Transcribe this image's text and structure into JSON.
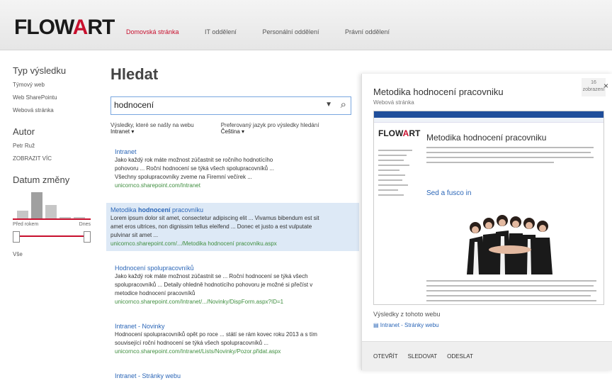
{
  "header": {
    "logo_main": "FLOW",
    "logo_accent": "A",
    "logo_end": "RT",
    "nav": [
      "Domovská stránka",
      "IT oddělení",
      "Personální oddělení",
      "Právní oddělení"
    ]
  },
  "refiners": {
    "type_heading": "Typ výsledku",
    "type_items": [
      "Týmový web",
      "Web SharePointu",
      "Webová stránka"
    ],
    "author_heading": "Autor",
    "author_items": [
      "Petr Ruž",
      "ZOBRAZIT VÍC"
    ],
    "date_heading": "Datum změny",
    "date_from": "Před rokem",
    "date_to": "Dnes",
    "date_all": "Vše"
  },
  "search": {
    "title": "Hledat",
    "query": "hodnocení",
    "scope_label": "Výsledky, které se našly na webu",
    "scope_value": "Intranet",
    "lang_label": "Preferovaný jazyk pro výsledky hledání",
    "lang_value": "Čeština"
  },
  "results": [
    {
      "title": "Intranet",
      "desc1": "Jako každý rok máte možnost zúčastnit se ročního hodnotícího",
      "desc2": "pohovoru ... Roční hodnocení se týká všech spolupracovníků ...",
      "desc3": "Všechny spolupracovníky zveme na Firemní večírek ...",
      "url": "unicornco.sharepoint.com/Intranet"
    },
    {
      "title_pre": "Metodika ",
      "title_bold": "hodnocení",
      "title_post": " pracovníku",
      "desc1": "Lorem ipsum dolor sit amet, consectetur adipiscing elit ... Vivamus bibendum est sit",
      "desc2": "amet eros ultrices, non dignissim tellus eleifend ... Donec et justo a est vulputate",
      "desc3": "pulvinar sit amet ...",
      "url": "unicornco.sharepoint.com/.../Metodika hodnocení pracovniku.aspx"
    },
    {
      "title": "Hodnocení spolupracovníků",
      "desc1": "Jako každý rok máte možnost zúčastnit se ... Roční hodnocení se týká všech",
      "desc2": "spolupracovníků ... Detaily ohledně hodnotícího pohovoru je možné si přečíst v",
      "desc3": "metodice hodnocení pracovníků",
      "url": "unicornco.sharepoint.com/Intranet/.../Novinky/DispForm.aspx?ID=1"
    },
    {
      "title": "Intranet - Novinky",
      "desc1": "Hodnocení spolupracovníků opět po roce ... státí se rám kovec roku 2013 a s tím",
      "desc2": "související roční hodnocení se týká všech spolupracovníků ...",
      "url": "unicornco.sharepoint.com/Intranet/Lists/Novinky/Pozor.přidat.aspx"
    },
    {
      "title": "Intranet - Stránky webu"
    }
  ],
  "preview": {
    "title": "Metodika hodnocení pracovniku",
    "subtitle": "Webová stránka",
    "views_count": "16",
    "views_label": "zobrazení",
    "thumb_title": "Metodika hodnocení pracovniku",
    "thumb_link": "Sed a fusco in",
    "related_heading": "Výsledky z tohoto webu",
    "related_link": "Intranet - Stránky webu",
    "actions": [
      "OTEVŘÍT",
      "SLEDOVAT",
      "ODESLAT"
    ],
    "close": "×"
  },
  "colors": {
    "brand_red": "#c8102e",
    "link_blue": "#2b66b7",
    "url_green": "#3f8e3f",
    "selection": "#dde9f6"
  }
}
